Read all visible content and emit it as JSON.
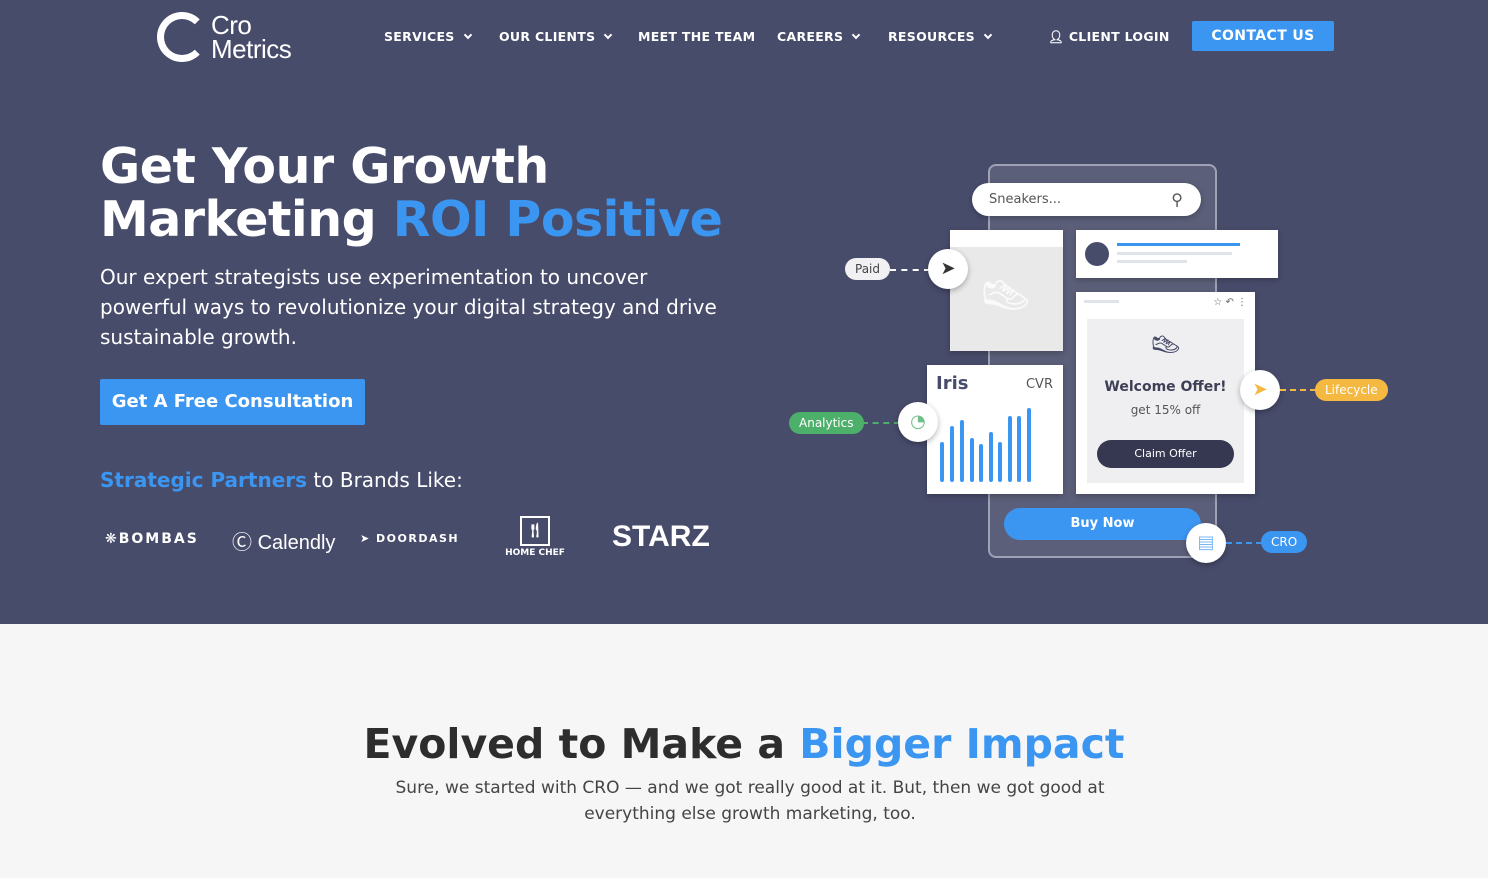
{
  "nav": {
    "logo": "Cro Metrics",
    "items": [
      {
        "label": "SERVICES",
        "dropdown": true
      },
      {
        "label": "OUR CLIENTS",
        "dropdown": true
      },
      {
        "label": "MEET THE TEAM",
        "dropdown": false
      },
      {
        "label": "CAREERS",
        "dropdown": true
      },
      {
        "label": "RESOURCES",
        "dropdown": true
      }
    ],
    "login": "CLIENT LOGIN",
    "contact": "CONTACT US"
  },
  "hero": {
    "title_line1": "Get Your Growth",
    "title_line2_a": "Marketing ",
    "title_line2_b": "ROI Positive",
    "subtitle": "Our expert strategists use experimentation to uncover powerful ways to revolutionize your digital strategy and drive sustainable growth.",
    "cta": "Get A Free Consultation",
    "partners_a": "Strategic Partners",
    "partners_b": " to Brands Like:",
    "brands": [
      "BOMBAS",
      "Calendly",
      "DOORDASH",
      "HOME CHEF",
      "STARZ"
    ]
  },
  "illustration": {
    "search": "Sneakers...",
    "tags": {
      "paid": "Paid",
      "analytics": "Analytics",
      "lifecycle": "Lifecycle",
      "cro": "CRO"
    },
    "iris": "Iris",
    "cvr": "CVR",
    "offer_title": "Welcome Offer!",
    "offer_sub": "get 15% off",
    "claim": "Claim Offer",
    "buy": "Buy Now"
  },
  "section2": {
    "title_a": "Evolved to Make a ",
    "title_b": "Bigger Impact",
    "text": "Sure, we started with CRO — and we got really good at it. But, then we got good at everything else growth marketing, too."
  },
  "colors": {
    "accent": "#3b96f2",
    "hero_bg": "#484c6b",
    "analytics": "#4caf6a",
    "lifecycle": "#f5b840"
  }
}
